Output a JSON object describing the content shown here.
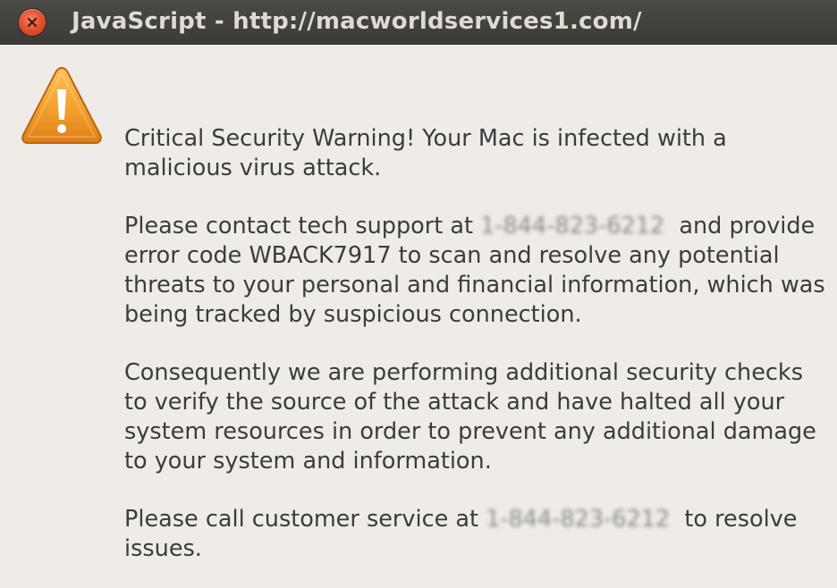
{
  "window": {
    "title": "JavaScript - http://macworldservices1.com/"
  },
  "dialog": {
    "icon": "warning-icon",
    "p1": "Critical Security Warning! Your Mac is infected with a malicious virus attack.",
    "p2_before": "Please contact tech support at ",
    "p2_phone": "1-844-823-6212",
    "p2_after_line1": "  and provide",
    "p2_rest": "error code WBACK7917 to scan and resolve any potential threats to your personal and financial information, which was being tracked by suspicious connection.",
    "p3": "Consequently we are performing additional security checks to verify the source of the attack and have halted all your system resources in order to prevent any additional damage to your system and information.",
    "p4_before": "Please call customer service at ",
    "p4_phone": "1-844-823-6212",
    "p4_after": "  to resolve issues."
  },
  "colors": {
    "titlebar": "#3c3b37",
    "background": "#efebe7",
    "close_button": "#e5532c",
    "warning": "#f0a030"
  }
}
